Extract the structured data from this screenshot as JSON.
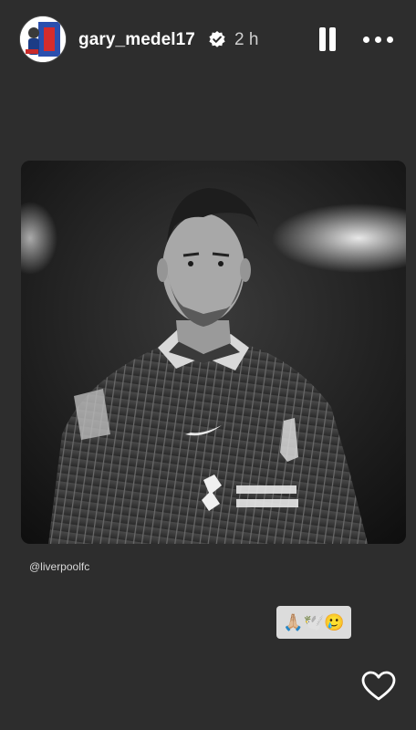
{
  "header": {
    "username": "gary_medel17",
    "time": "2 h",
    "verified_icon": "verified-badge-icon",
    "pause_icon": "pause-icon",
    "more_icon": "more-options-icon"
  },
  "post": {
    "image_desc_icon": "player-photo",
    "mention": "@liverpoolfc"
  },
  "sticker": {
    "emojis": "🙏🏼🕊️🥲"
  },
  "footer": {
    "like_icon": "heart-icon"
  },
  "colors": {
    "background": "#2d2d2d",
    "text": "#ffffff"
  }
}
